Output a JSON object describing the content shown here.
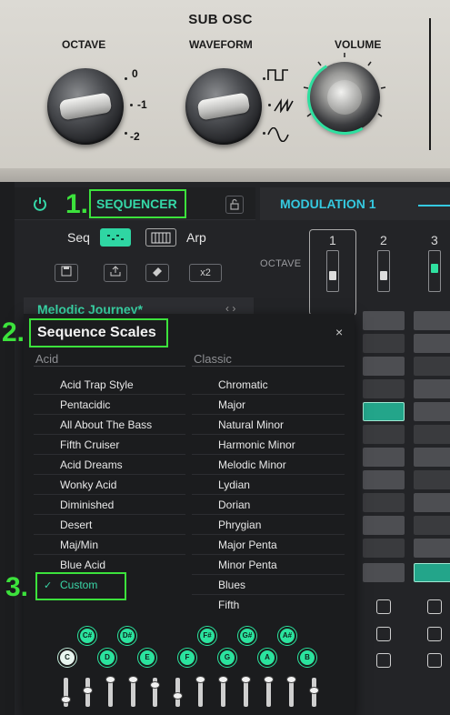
{
  "sub_osc": {
    "title": "SUB OSC",
    "octave_label": "OCTAVE",
    "waveform_label": "WAVEFORM",
    "volume_label": "VOLUME",
    "octave_options": [
      "0",
      "-1",
      "-2"
    ],
    "waveform_options": [
      "square-wave-icon",
      "saw-wave-icon",
      "sine-wave-icon"
    ]
  },
  "annotations": {
    "one": "1.",
    "two": "2.",
    "three": "3."
  },
  "sequencer": {
    "title": "SEQUENCER",
    "seq_label": "Seq",
    "arp_label": "Arp",
    "tools": [
      "save-icon",
      "export-icon",
      "eraser-icon",
      "x2"
    ],
    "preset_name": "Melodic Journey*",
    "preset_arrows": "‹ ›"
  },
  "modulation": {
    "title": "MODULATION 1"
  },
  "grid": {
    "octave_label": "OCTAVE",
    "step_numbers": [
      "1",
      "2",
      "3"
    ]
  },
  "popup": {
    "title": "Sequence Scales",
    "close": "×",
    "acid_header": "Acid",
    "classic_header": "Classic",
    "acid_items": [
      "Acid Trap Style",
      "Pentacidic",
      "All About The Bass",
      "Fifth Cruiser",
      "Acid Dreams",
      "Wonky Acid",
      "Diminished",
      "Desert",
      "Maj/Min",
      "Blue Acid",
      "Custom"
    ],
    "classic_items": [
      "Chromatic",
      "Major",
      "Natural Minor",
      "Harmonic Minor",
      "Melodic Minor",
      "Lydian",
      "Dorian",
      "Phrygian",
      "Major Penta",
      "Minor Penta",
      "Blues",
      "Fifth"
    ],
    "selected": "Custom",
    "check_mark": "✓",
    "sharp_notes": [
      "C#",
      "D#",
      "F#",
      "G#",
      "A#"
    ],
    "natural_notes": [
      "C",
      "D",
      "E",
      "F",
      "G",
      "A",
      "B"
    ]
  },
  "colors": {
    "accent": "#35d9a8",
    "highlight_box": "#3ce23c",
    "modulation": "#35c9e0"
  }
}
